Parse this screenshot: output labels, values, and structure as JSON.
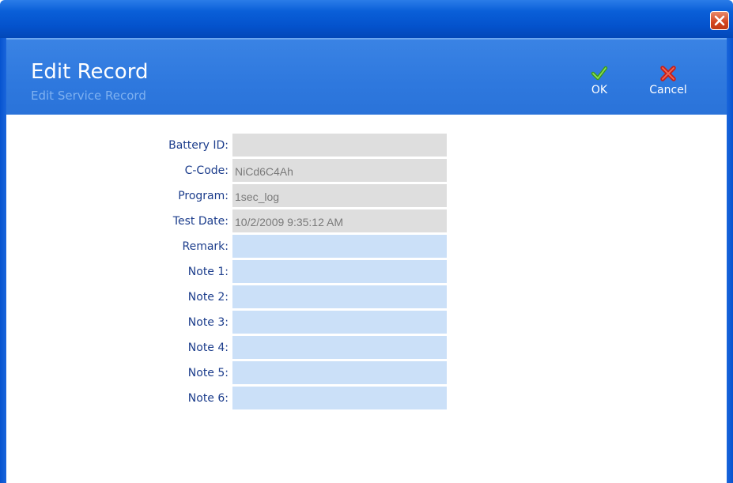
{
  "header": {
    "title": "Edit Record",
    "subtitle": "Edit Service Record"
  },
  "toolbar": {
    "ok_label": "OK",
    "cancel_label": "Cancel"
  },
  "fields": [
    {
      "label": "Battery ID:",
      "value": "",
      "editable": false
    },
    {
      "label": "C-Code:",
      "value": "NiCd6C4Ah",
      "editable": false
    },
    {
      "label": "Program:",
      "value": "1sec_log",
      "editable": false
    },
    {
      "label": "Test Date:",
      "value": "10/2/2009 9:35:12 AM",
      "editable": false
    },
    {
      "label": "Remark:",
      "value": "",
      "editable": true
    },
    {
      "label": "Note 1:",
      "value": "",
      "editable": true
    },
    {
      "label": "Note 2:",
      "value": "",
      "editable": true
    },
    {
      "label": "Note 3:",
      "value": "",
      "editable": true
    },
    {
      "label": "Note 4:",
      "value": "",
      "editable": true
    },
    {
      "label": "Note 5:",
      "value": "",
      "editable": true
    },
    {
      "label": "Note 6:",
      "value": "",
      "editable": true
    }
  ],
  "colors": {
    "titlebar": "#0452cc",
    "header": "#2e78de",
    "readonly_field": "#dedede",
    "editable_field": "#cbe0f8",
    "label": "#1c3d8c"
  },
  "icons": {
    "close": "close-icon",
    "ok": "checkmark-icon",
    "cancel": "x-icon"
  }
}
